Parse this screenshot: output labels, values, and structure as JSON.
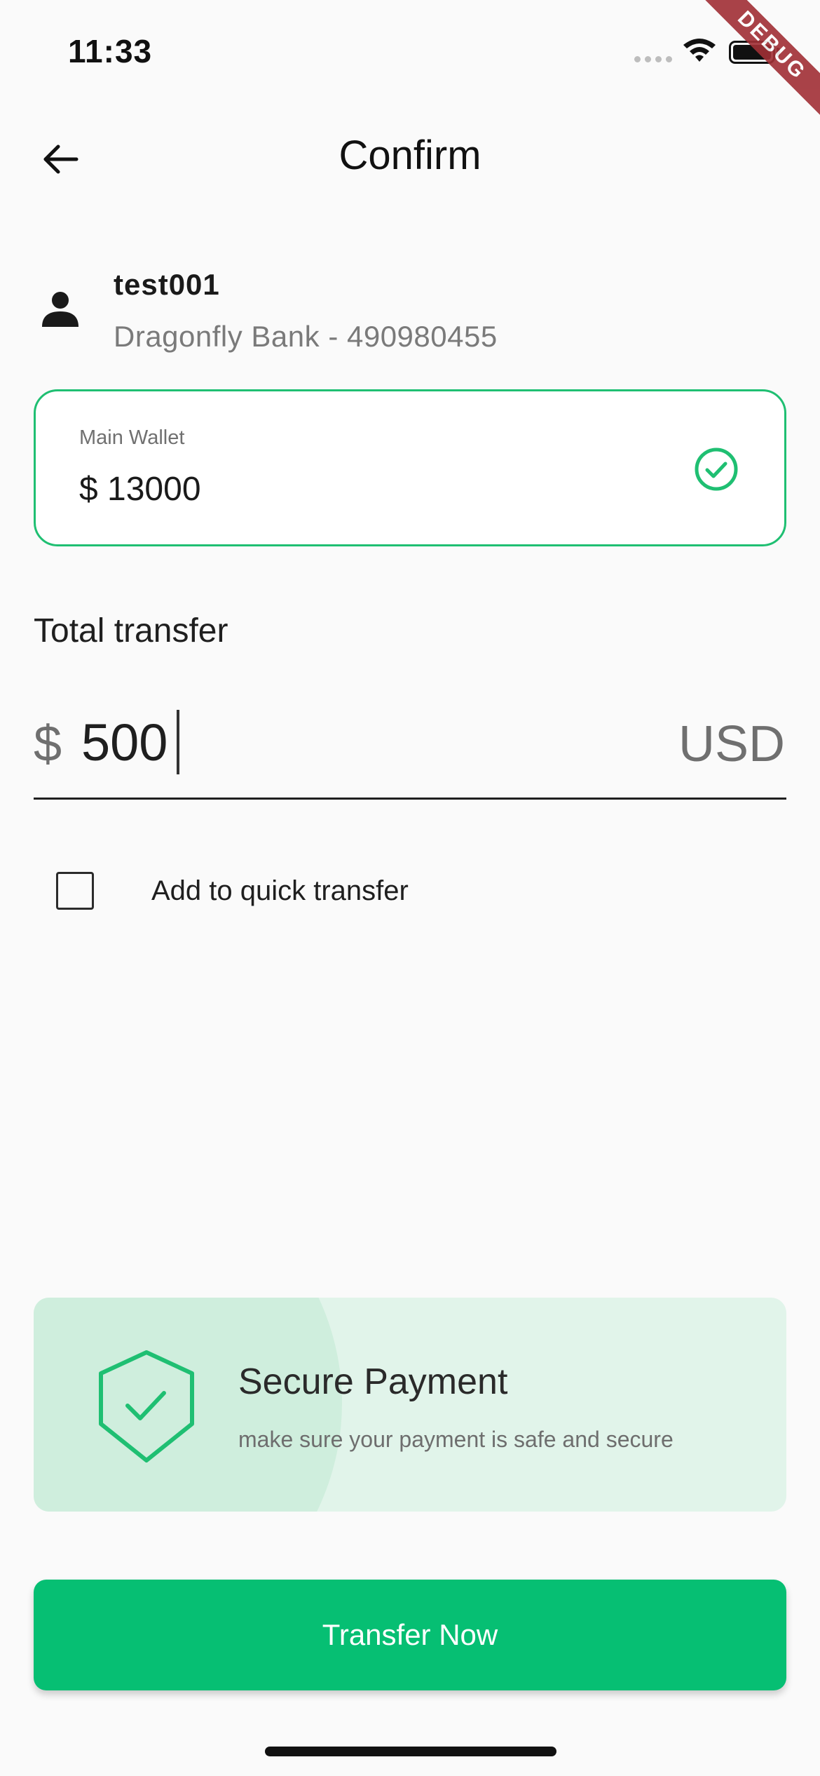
{
  "status_bar": {
    "time": "11:33",
    "icons": [
      "signal-icon",
      "wifi-icon",
      "battery-icon"
    ]
  },
  "debug_ribbon": "DEBUG",
  "app_bar": {
    "title": "Confirm",
    "back_icon": "arrow-back-icon"
  },
  "recipient": {
    "icon": "person-icon",
    "name": "test001",
    "bank_account": "Dragonfly Bank - 490980455"
  },
  "wallet": {
    "label": "Main Wallet",
    "amount": "$ 13000",
    "selected_icon": "check-circle-icon"
  },
  "transfer": {
    "label": "Total transfer",
    "currency_symbol": "$",
    "amount": "500",
    "currency_code": "USD"
  },
  "quick_transfer": {
    "checked": false,
    "label": "Add to quick transfer"
  },
  "secure_banner": {
    "icon": "shield-check-icon",
    "title": "Secure Payment",
    "description": "make sure your payment is safe and secure"
  },
  "actions": {
    "transfer_label": "Transfer Now"
  },
  "colors": {
    "accent": "#06bf73",
    "accent_border": "#1fbf72",
    "banner_bg": "#e1f4ea",
    "banner_circle": "#cfeedd",
    "background": "#fafafa",
    "debug_ribbon": "#a12f35"
  }
}
